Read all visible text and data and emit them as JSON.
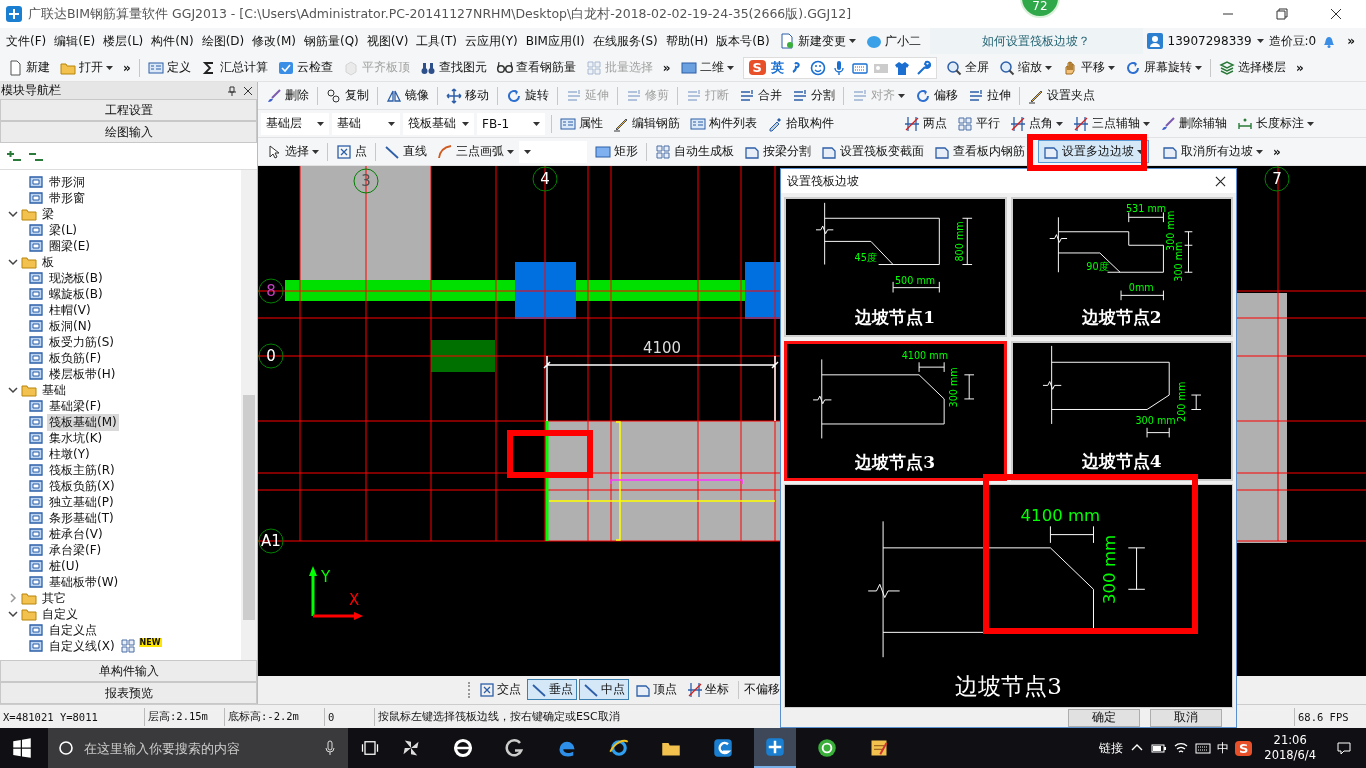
{
  "window": {
    "title": "广联达BIM钢筋算量软件 GGJ2013 - [C:\\Users\\Administrator.PC-20141127NRHM\\Desktop\\白龙村-2018-02-02-19-24-35(2666版).GGJ12]",
    "badge": "72"
  },
  "menu": [
    "文件(F)",
    "编辑(E)",
    "楼层(L)",
    "构件(N)",
    "绘图(D)",
    "修改(M)",
    "钢筋量(Q)",
    "视图(V)",
    "工具(T)",
    "云应用(Y)",
    "BIM应用(I)",
    "在线服务(S)",
    "帮助(H)",
    "版本号(B)"
  ],
  "menu_extras": [
    {
      "label": "新建变更",
      "dropdown": true
    },
    {
      "label": "广小二",
      "dropdown": false
    }
  ],
  "help_link": "如何设置筏板边坡？",
  "account": {
    "user": "13907298339",
    "beans": "造价豆:0",
    "overflow": "»"
  },
  "toolbar_main": [
    {
      "kind": "button",
      "label": "新建",
      "disabled": false,
      "dropdown": false
    },
    {
      "kind": "button",
      "label": "打开",
      "disabled": false,
      "dropdown": true
    },
    {
      "kind": "overflow",
      "label": "»"
    },
    {
      "kind": "separator"
    },
    {
      "kind": "button",
      "label": "定义",
      "disabled": false,
      "dropdown": false
    },
    {
      "kind": "button",
      "label": "汇总计算",
      "disabled": false,
      "dropdown": false
    },
    {
      "kind": "button",
      "label": "云检查",
      "disabled": false,
      "dropdown": false
    },
    {
      "kind": "button",
      "label": "平齐板顶",
      "disabled": true,
      "dropdown": false
    },
    {
      "kind": "button",
      "label": "查找图元",
      "disabled": false,
      "dropdown": false
    },
    {
      "kind": "button",
      "label": "查看钢筋量",
      "disabled": false,
      "dropdown": false
    },
    {
      "kind": "button",
      "label": "批量选择",
      "disabled": true,
      "dropdown": false
    },
    {
      "kind": "overflow",
      "label": "»"
    },
    {
      "kind": "button",
      "label": "二维",
      "disabled": false,
      "dropdown": true
    },
    {
      "kind": "ime",
      "logo": "S",
      "mode": "英"
    },
    {
      "kind": "button",
      "label": "全屏",
      "disabled": false,
      "dropdown": false
    },
    {
      "kind": "button",
      "label": "缩放",
      "disabled": false,
      "dropdown": true
    },
    {
      "kind": "button",
      "label": "平移",
      "disabled": false,
      "dropdown": true
    },
    {
      "kind": "button",
      "label": "屏幕旋转",
      "disabled": false,
      "dropdown": true
    },
    {
      "kind": "separator"
    },
    {
      "kind": "button",
      "label": "选择楼层",
      "disabled": false,
      "dropdown": false
    },
    {
      "kind": "overflow",
      "label": "»"
    }
  ],
  "nav_panel": {
    "title": "模块导航栏",
    "buttons": [
      "工程设置",
      "绘图输入"
    ],
    "tree": [
      {
        "children": [
          {
            "label": "带形洞",
            "selected": false
          },
          {
            "label": "带形窗",
            "selected": false
          }
        ]
      },
      {
        "label": "梁",
        "expanded": true,
        "children": [
          {
            "label": "梁(L)",
            "selected": false
          },
          {
            "label": "圈梁(E)",
            "selected": false
          }
        ]
      },
      {
        "label": "板",
        "expanded": true,
        "children": [
          {
            "label": "现浇板(B)",
            "selected": false
          },
          {
            "label": "螺旋板(B)",
            "selected": false
          },
          {
            "label": "柱帽(V)",
            "selected": false
          },
          {
            "label": "板洞(N)",
            "selected": false
          },
          {
            "label": "板受力筋(S)",
            "selected": false
          },
          {
            "label": "板负筋(F)",
            "selected": false
          },
          {
            "label": "楼层板带(H)",
            "selected": false
          }
        ]
      },
      {
        "label": "基础",
        "expanded": true,
        "children": [
          {
            "label": "基础梁(F)",
            "selected": false
          },
          {
            "label": "筏板基础(M)",
            "selected": true
          },
          {
            "label": "集水坑(K)",
            "selected": false
          },
          {
            "label": "柱墩(Y)",
            "selected": false
          },
          {
            "label": "筏板主筋(R)",
            "selected": false
          },
          {
            "label": "筏板负筋(X)",
            "selected": false
          },
          {
            "label": "独立基础(P)",
            "selected": false
          },
          {
            "label": "条形基础(T)",
            "selected": false
          },
          {
            "label": "桩承台(V)",
            "selected": false
          },
          {
            "label": "承台梁(F)",
            "selected": false
          },
          {
            "label": "桩(U)",
            "selected": false
          },
          {
            "label": "基础板带(W)",
            "selected": false
          }
        ]
      },
      {
        "label": "其它",
        "expanded": false
      },
      {
        "label": "自定义",
        "expanded": true,
        "children": [
          {
            "label": "自定义点",
            "selected": false
          },
          {
            "label": "自定义线(X)",
            "selected": false,
            "badge": "NEW"
          }
        ]
      }
    ],
    "bottom_buttons": [
      "单构件输入",
      "报表预览"
    ]
  },
  "toolbar_edit": [
    {
      "kind": "button",
      "label": "删除",
      "disabled": false
    },
    {
      "kind": "separator"
    },
    {
      "kind": "button",
      "label": "复制",
      "disabled": false
    },
    {
      "kind": "separator"
    },
    {
      "kind": "button",
      "label": "镜像",
      "disabled": false
    },
    {
      "kind": "separator"
    },
    {
      "kind": "button",
      "label": "移动",
      "disabled": false
    },
    {
      "kind": "separator"
    },
    {
      "kind": "button",
      "label": "旋转",
      "disabled": false
    },
    {
      "kind": "separator"
    },
    {
      "kind": "button",
      "label": "延伸",
      "disabled": true
    },
    {
      "kind": "separator"
    },
    {
      "kind": "button",
      "label": "修剪",
      "disabled": true
    },
    {
      "kind": "separator"
    },
    {
      "kind": "button",
      "label": "打断",
      "disabled": true
    },
    {
      "kind": "button",
      "label": "合并",
      "disabled": false
    },
    {
      "kind": "button",
      "label": "分割",
      "disabled": false
    },
    {
      "kind": "separator"
    },
    {
      "kind": "button",
      "label": "对齐",
      "disabled": true,
      "dropdown": true
    },
    {
      "kind": "button",
      "label": "偏移",
      "disabled": false
    },
    {
      "kind": "button",
      "label": "拉伸",
      "disabled": false
    },
    {
      "kind": "separator"
    },
    {
      "kind": "button",
      "label": "设置夹点",
      "disabled": false
    }
  ],
  "toolbar_component": [
    {
      "kind": "select",
      "value": "基础层"
    },
    {
      "kind": "select",
      "value": "基础"
    },
    {
      "kind": "select",
      "value": "筏板基础"
    },
    {
      "kind": "select",
      "value": "FB-1"
    },
    {
      "kind": "separator"
    },
    {
      "kind": "button",
      "label": "属性"
    },
    {
      "kind": "button",
      "label": "编辑钢筋"
    },
    {
      "kind": "button",
      "label": "构件列表"
    },
    {
      "kind": "button",
      "label": "拾取构件"
    }
  ],
  "toolbar_axis": [
    {
      "kind": "button",
      "label": "两点"
    },
    {
      "kind": "button",
      "label": "平行"
    },
    {
      "kind": "button",
      "label": "点角",
      "dropdown": true
    },
    {
      "kind": "button",
      "label": "三点辅轴",
      "dropdown": true
    },
    {
      "kind": "button",
      "label": "删除辅轴"
    },
    {
      "kind": "button",
      "label": "长度标注",
      "dropdown": true
    }
  ],
  "toolbar_draw": [
    {
      "kind": "button",
      "label": "选择",
      "dropdown": true,
      "selected": false
    },
    {
      "kind": "separator"
    },
    {
      "kind": "button",
      "label": "点",
      "selected": false
    },
    {
      "kind": "separator"
    },
    {
      "kind": "button",
      "label": "直线",
      "selected": false
    },
    {
      "kind": "button",
      "label": "三点画弧",
      "dropdown": true,
      "selected": false
    },
    {
      "kind": "select"
    },
    {
      "kind": "button",
      "label": "矩形",
      "selected": false
    },
    {
      "kind": "separator"
    },
    {
      "kind": "button",
      "label": "自动生成板",
      "selected": false
    },
    {
      "kind": "button",
      "label": "按梁分割",
      "selected": false
    },
    {
      "kind": "button",
      "label": "设置筏板变截面",
      "selected": false
    },
    {
      "kind": "button",
      "label": "查看板内钢筋",
      "selected": false
    },
    {
      "kind": "button",
      "label": "设置多边边坡",
      "dropdown": true,
      "selected": true
    },
    {
      "kind": "button",
      "label": "取消所有边坡",
      "dropdown": true,
      "selected": false
    },
    {
      "kind": "overflow",
      "label": "»"
    }
  ],
  "canvas": {
    "axes": [
      {
        "label": "3",
        "color": "#505050"
      },
      {
        "label": "4",
        "color": "#ffffff"
      },
      {
        "label": "7",
        "color": "#ffffff"
      },
      {
        "label": "8",
        "color": "#c040c0"
      },
      {
        "label": "0",
        "color": "#ffffff"
      },
      {
        "label": "A1",
        "color": "#ffffff"
      }
    ],
    "dimension": "4100",
    "axis_letters": [
      "Y",
      "X"
    ]
  },
  "snap_bar": {
    "items": [
      {
        "label": "交点",
        "selected": false
      },
      {
        "label": "垂点",
        "selected": true
      },
      {
        "label": "中点",
        "selected": true
      },
      {
        "label": "顶点",
        "selected": false
      },
      {
        "label": "坐标",
        "selected": false
      }
    ],
    "offset": "不偏移"
  },
  "status_bar": {
    "coords": "X=481021 Y=8011",
    "floor_height": "层高:2.15m",
    "bottom_elevation": "底标高:-2.2m",
    "value": "0",
    "hint": "按鼠标左键选择筏板边线，按右键确定或ESC取消",
    "fps": "68.6 FPS"
  },
  "dialog": {
    "title": "设置筏板边坡",
    "options": [
      {
        "kind": "angle",
        "label": "边坡节点1",
        "selected": false,
        "dims": [
          "45度",
          "500 mm",
          "800 mm"
        ]
      },
      {
        "kind": "step",
        "label": "边坡节点2",
        "selected": false,
        "dims": [
          "531 mm",
          "300 mm",
          "300 mm",
          "90度",
          "0mm"
        ]
      },
      {
        "kind": "width",
        "label": "边坡节点3",
        "selected": true,
        "dims": [
          "4100 mm",
          "300 mm"
        ]
      },
      {
        "kind": "height",
        "label": "边坡节点4",
        "selected": false,
        "dims": [
          "200 mm",
          "300 mm"
        ]
      }
    ],
    "preview": {
      "kind": "width",
      "label": "边坡节点3",
      "dims": [
        "4100 mm",
        "300 mm"
      ]
    },
    "buttons": [
      "确定",
      "取消"
    ]
  },
  "taskbar": {
    "search_placeholder": "在这里输入你要搜索的内容",
    "apps": [
      {
        "selected": false
      },
      {
        "selected": false
      },
      {
        "selected": false
      },
      {
        "selected": false
      },
      {
        "selected": false
      },
      {
        "selected": false
      },
      {
        "selected": false
      },
      {
        "selected": true
      },
      {
        "selected": false
      },
      {
        "selected": false
      }
    ],
    "tray": {
      "link": "链接",
      "ime": "中",
      "ime_logo": "S",
      "time": "21:06",
      "date": "2018/6/4"
    }
  }
}
